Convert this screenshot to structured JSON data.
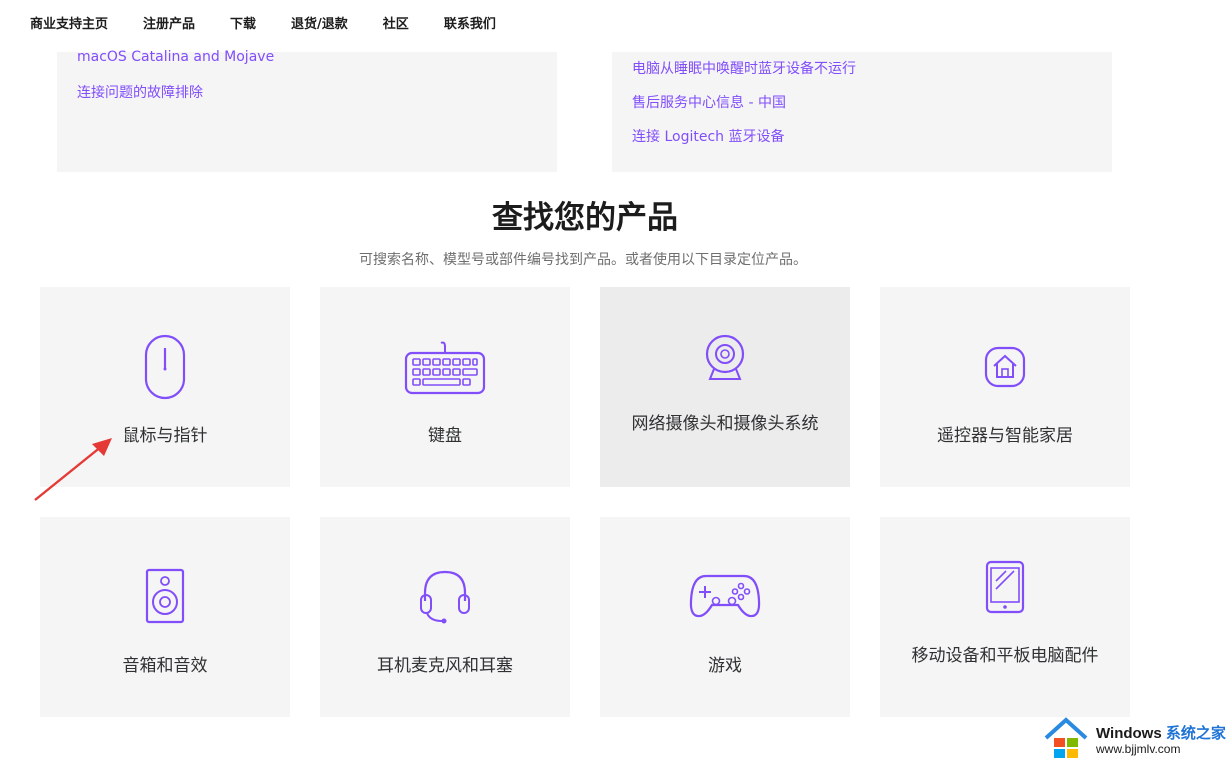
{
  "nav": {
    "items": [
      "商业支持主页",
      "注册产品",
      "下载",
      "退货/退款",
      "社区",
      "联系我们"
    ]
  },
  "panels": {
    "left_links": [
      "macOS Catalina and Mojave",
      "连接问题的故障排除"
    ],
    "right_links": [
      "电脑从睡眠中唤醒时蓝牙设备不运行",
      "售后服务中心信息 - 中国",
      "连接 Logitech 蓝牙设备"
    ]
  },
  "products_section": {
    "title": "查找您的产品",
    "subtitle": "可搜索名称、模型号或部件编号找到产品。或者使用以下目录定位产品。",
    "categories": [
      {
        "label": "鼠标与指针",
        "icon": "mouse-icon"
      },
      {
        "label": "键盘",
        "icon": "keyboard-icon"
      },
      {
        "label": "网络摄像头和摄像头系统",
        "icon": "webcam-icon"
      },
      {
        "label": "遥控器与智能家居",
        "icon": "smart-home-icon"
      },
      {
        "label": "音箱和音效",
        "icon": "speaker-icon"
      },
      {
        "label": "耳机麦克风和耳塞",
        "icon": "headset-icon"
      },
      {
        "label": "游戏",
        "icon": "gamepad-icon"
      },
      {
        "label": "移动设备和平板电脑配件",
        "icon": "tablet-icon"
      }
    ]
  },
  "watermark": {
    "brand": "Windows",
    "brand_cn": "系统之家",
    "url": "www.bjjmlv.com"
  },
  "colors": {
    "accent": "#814efa",
    "card_bg": "#f5f5f5",
    "arrow": "#e53935"
  }
}
